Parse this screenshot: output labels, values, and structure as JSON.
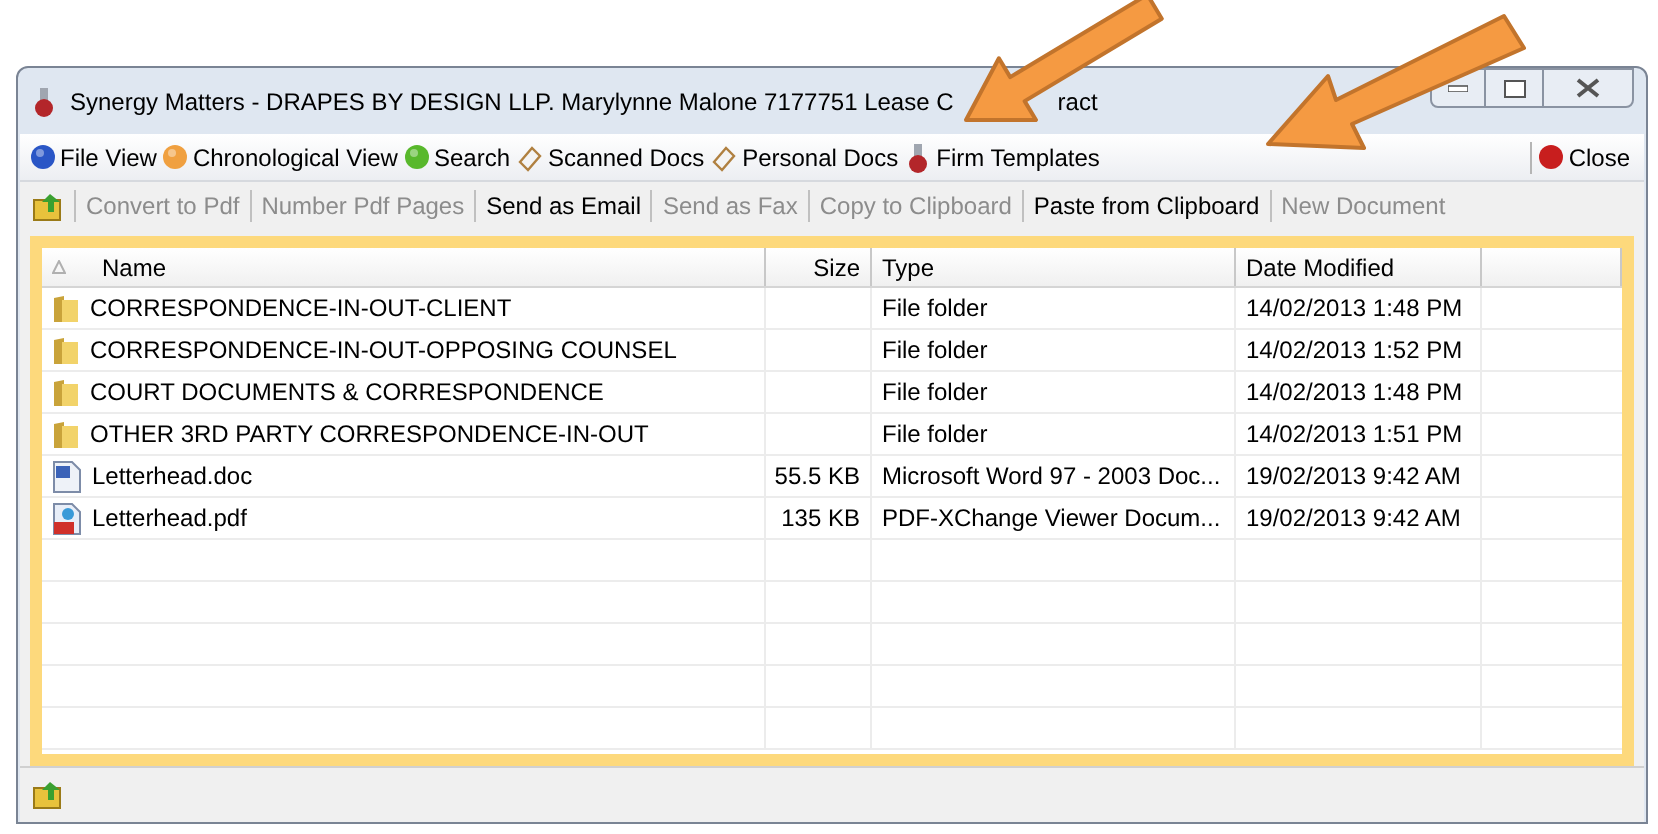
{
  "window": {
    "title": "Synergy Matters - DRAPES BY DESIGN LLP. Marylynne Malone 7177751 Lease C",
    "title_tail": "ract"
  },
  "menu": [
    {
      "label": "File View",
      "kind": "blue"
    },
    {
      "label": "Chronological View",
      "kind": "orange"
    },
    {
      "label": "Search",
      "kind": "green"
    },
    {
      "label": "Scanned Docs",
      "kind": "clip"
    },
    {
      "label": "Personal Docs",
      "kind": "clip"
    },
    {
      "label": "Firm Templates",
      "kind": "flask"
    }
  ],
  "close_button": {
    "label": "Close"
  },
  "toolbar": [
    {
      "label": "Convert to Pdf",
      "disabled": true
    },
    {
      "label": "Number Pdf Pages",
      "disabled": true
    },
    {
      "label": "Send as Email",
      "disabled": false
    },
    {
      "label": "Send as Fax",
      "disabled": true
    },
    {
      "label": "Copy to Clipboard",
      "disabled": true
    },
    {
      "label": "Paste from Clipboard",
      "disabled": false
    },
    {
      "label": "New Document",
      "disabled": true
    }
  ],
  "table": {
    "columns": [
      "Name",
      "Size",
      "Type",
      "Date Modified"
    ],
    "rows": [
      {
        "kind": "folder",
        "name": "CORRESPONDENCE-IN-OUT-CLIENT",
        "size": "",
        "type": "File folder",
        "date": "14/02/2013 1:48 PM"
      },
      {
        "kind": "folder",
        "name": "CORRESPONDENCE-IN-OUT-OPPOSING COUNSEL",
        "size": "",
        "type": "File folder",
        "date": "14/02/2013 1:52 PM"
      },
      {
        "kind": "folder",
        "name": "COURT DOCUMENTS & CORRESPONDENCE",
        "size": "",
        "type": "File folder",
        "date": "14/02/2013 1:48 PM"
      },
      {
        "kind": "folder",
        "name": "OTHER 3RD PARTY CORRESPONDENCE-IN-OUT",
        "size": "",
        "type": "File folder",
        "date": "14/02/2013 1:51 PM"
      },
      {
        "kind": "word",
        "name": "Letterhead.doc",
        "size": "55.5 KB",
        "type": "Microsoft Word 97 - 2003 Doc...",
        "date": "19/02/2013 9:42 AM"
      },
      {
        "kind": "pdf",
        "name": "Letterhead.pdf",
        "size": "135 KB",
        "type": "PDF-XChange Viewer Docum...",
        "date": "19/02/2013 9:42 AM"
      }
    ]
  }
}
